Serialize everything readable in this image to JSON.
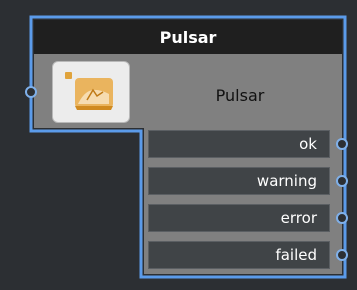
{
  "node": {
    "title": "Pulsar",
    "label": "Pulsar",
    "icon": "pulsar-icon",
    "outputs": [
      {
        "label": "ok"
      },
      {
        "label": "warning"
      },
      {
        "label": "error"
      },
      {
        "label": "failed"
      }
    ]
  },
  "colors": {
    "background": "#2c2f33",
    "node_border": "#5b9bea",
    "header": "#1f1f1f",
    "body": "#808080",
    "port_row": "#404447",
    "icon_accent": "#e0a33b"
  }
}
